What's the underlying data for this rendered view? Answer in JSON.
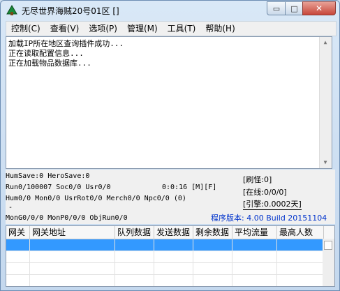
{
  "window": {
    "title": "无尽世界海贼20号01区 []",
    "buttons": {
      "minimize": "▭",
      "maximize": "□",
      "close": "✕"
    }
  },
  "menu": [
    "控制(C)",
    "查看(V)",
    "选项(P)",
    "管理(M)",
    "工具(T)",
    "帮助(H)"
  ],
  "log_lines": [
    "加载IP所在地区查询插件成功...",
    "正在读取配置信息...",
    "正在加载物品数据库..."
  ],
  "status": {
    "line1": "HumSave:0 HeroSave:0",
    "line2": "Run0/100007 Soc0/0 Usr0/0",
    "time": "0:0:16 [M][F]",
    "line3": "Hum0/0 Mon0/0 UsrRot0/0 Merch0/0 Npc0/0 (0)",
    "dash": "-",
    "line4": "MonG0/0/0 MonP0/0/0 ObjRun0/0",
    "refresh": "[刷怪:0]",
    "online": "[在线:0/0/0]",
    "engine": "[引擎:0.0002天]",
    "version": "程序版本: 4.00 Build 20151104"
  },
  "table": {
    "columns": [
      "网关",
      "网关地址",
      "队列数据",
      "发送数据",
      "剩余数据",
      "平均流量",
      "最高人数"
    ]
  },
  "colors": {
    "selection": "#3399ff",
    "version_text": "#0033cc",
    "close_button": "#c7463a"
  }
}
